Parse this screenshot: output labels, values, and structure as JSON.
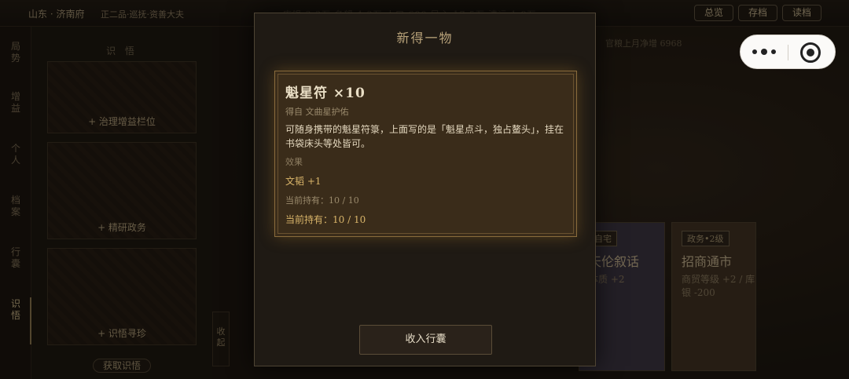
{
  "topbar": {
    "location": "山东 · 济南府",
    "rank": "正二品·巡抚·资善大夫",
    "stats_faded": "库银 3.3万   名望 4.3万   人口 600   民心 17.5万   漕运 1.8万",
    "buttons": [
      "总览",
      "存档",
      "读档"
    ]
  },
  "leftnav": {
    "items": [
      "局势",
      "增益",
      "个人",
      "档案",
      "行囊",
      "识悟"
    ],
    "active": "识悟",
    "extra_icon": "◎"
  },
  "panel": {
    "title": "识 悟",
    "cards": [
      "+ 治理增益栏位",
      "+ 精研政务",
      "+ 识悟寻珍"
    ],
    "get_button": "获取识悟",
    "collapse_label": "收起"
  },
  "main": {
    "salary": "官粮上月净增 6968",
    "cards": [
      {
        "tag": "自宅",
        "name": "天伦叙话",
        "effect": "体质 +2"
      },
      {
        "tag": "政务•2级",
        "name": "招商通市",
        "effect": "商贸等级 +2 / 库银 -200"
      }
    ]
  },
  "capsule": {
    "icon_menu": "more-dots-icon",
    "icon_close": "target-icon"
  },
  "modal": {
    "title": "新得一物",
    "item": {
      "name": "魁星符 ×10",
      "source": "得自 文曲星护佑",
      "description": "可随身携带的魁星符箓，上面写的是「魁星点斗，独占鳌头」，挂在书袋床头等处皆可。",
      "effect_label": "效果",
      "effect": "文韬 +1",
      "held_a": "当前持有：10 / 10",
      "held_b": "当前持有：10 / 10"
    },
    "collect_button": "收入行囊"
  },
  "colors": {
    "accent_gold": "#d9b56a",
    "modal_bg": "#1f1a14",
    "card_bg": "#3a2c1a"
  }
}
